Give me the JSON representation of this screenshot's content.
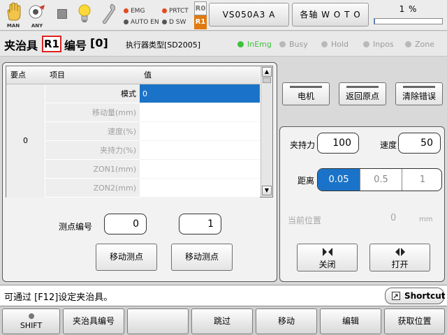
{
  "toolbar": {
    "icons": [
      {
        "name": "man-hand-icon",
        "caption": "MAN"
      },
      {
        "name": "any-icon",
        "caption": "ANY"
      },
      {
        "name": "stop-icon",
        "caption": ""
      },
      {
        "name": "lightbulb-icon",
        "caption": ""
      },
      {
        "name": "wrench-icon",
        "caption": ""
      }
    ],
    "lamps": {
      "emg": "EMG",
      "auto_en": "AUTO EN",
      "prtct": "PRTCT",
      "dsw": "D SW"
    },
    "r0": "R0",
    "r1": "R1",
    "robot_button": "VS050A3 A",
    "axis_button": "各轴 W O T O",
    "speed_percent": "1 %",
    "speed_value": 1
  },
  "title": {
    "prefix": "夹治具",
    "fixture_id": "R1",
    "number_label": "编号",
    "number_value": "[0]",
    "actuator_type": "执行器类型[SD2005]"
  },
  "status_indicators": [
    {
      "label": "InEmg",
      "active": true
    },
    {
      "label": "Busy",
      "active": false
    },
    {
      "label": "Hold",
      "active": false
    },
    {
      "label": "Inpos",
      "active": false
    },
    {
      "label": "Zone",
      "active": false
    }
  ],
  "table": {
    "headers": [
      "要点",
      "项目",
      "值"
    ],
    "point": "0",
    "rows": [
      {
        "item": "模式",
        "value": "0",
        "selected": true
      },
      {
        "item": "移动量(mm)",
        "value": ""
      },
      {
        "item": "速度(%)",
        "value": ""
      },
      {
        "item": "夹持力(%)",
        "value": ""
      },
      {
        "item": "ZON1(mm)",
        "value": ""
      },
      {
        "item": "ZON2(mm)",
        "value": ""
      }
    ]
  },
  "left_controls": {
    "point_number_label": "测点编号",
    "point_number_from": "0",
    "point_number_to": "1",
    "move_point_1": "移动测点",
    "move_point_2": "移动测点"
  },
  "right_buttons": {
    "motor": "电机",
    "return_origin": "返回原点",
    "clear_error": "清除错误"
  },
  "gripper": {
    "force_label": "夹持力",
    "force_value": "100",
    "speed_label": "速度",
    "speed_value": "50",
    "distance_label": "距离",
    "distance_options": [
      "0.05",
      "0.5",
      "1"
    ],
    "distance_selected": "0.05",
    "current_pos_label": "当前位置",
    "current_pos_value": "0",
    "current_pos_unit": "mm",
    "close_label": "关闭",
    "open_label": "打开"
  },
  "message": "可通过 [F12]设定夹治具。",
  "shortcut_label": "Shortcut",
  "function_keys": [
    "SHIFT",
    "夹治具编号",
    "",
    "跳过",
    "移动",
    "编辑",
    "获取位置"
  ],
  "colors": {
    "accent_blue": "#1a73c8",
    "status_green": "#3ec23e",
    "lamp_red": "#e34a1c",
    "r1_orange": "#e07a10"
  }
}
